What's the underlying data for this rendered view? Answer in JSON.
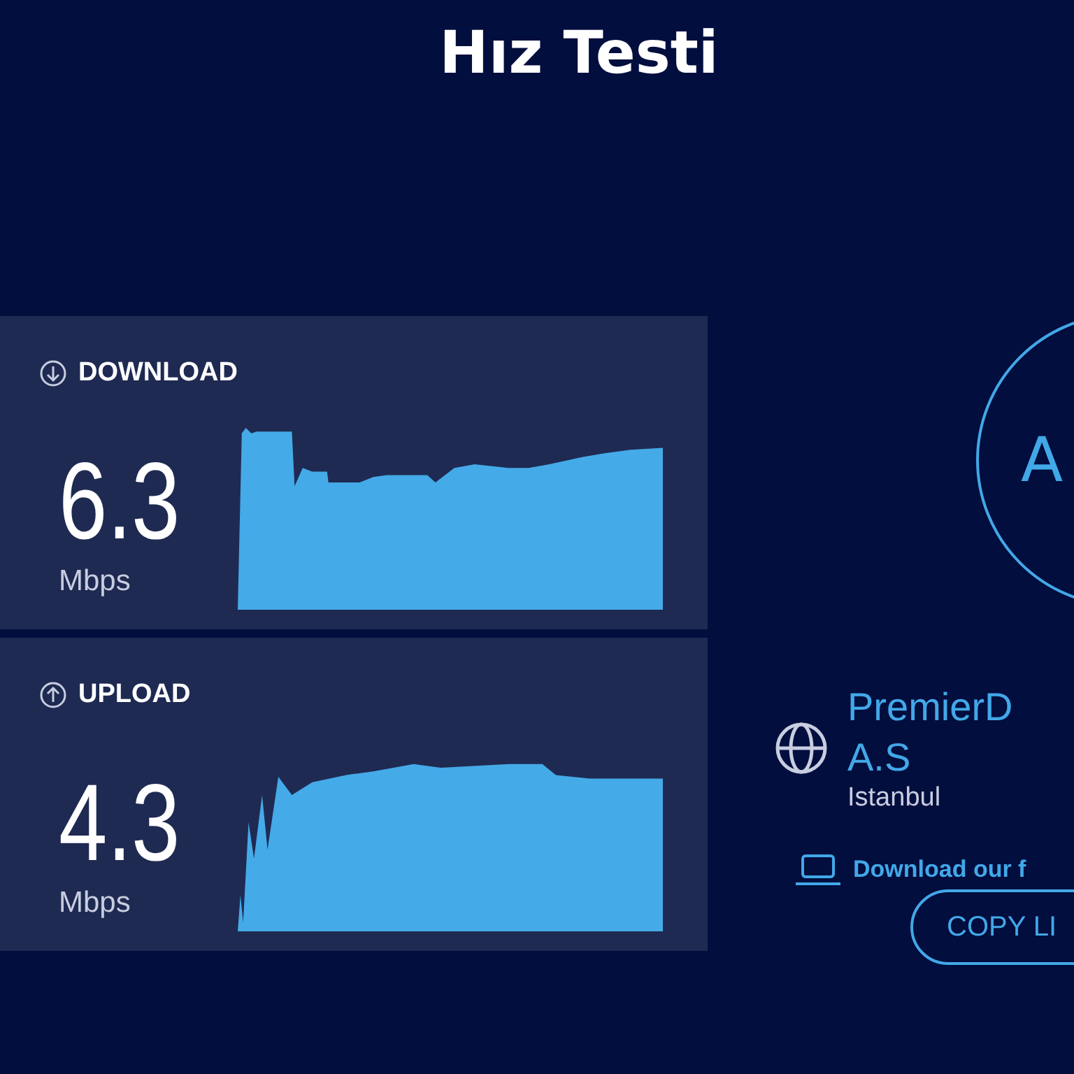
{
  "title": "Hız Testi",
  "results": [
    {
      "kind": "download",
      "label": "DOWNLOAD",
      "value": "6.3",
      "unit": "Mbps"
    },
    {
      "kind": "upload",
      "label": "UPLOAD",
      "value": "4.3",
      "unit": "Mbps"
    }
  ],
  "start_button": {
    "label": "A"
  },
  "provider": {
    "name": "PremierD",
    "name_line_2": "A.S",
    "location": "Istanbul"
  },
  "app_link": "Download our f",
  "copy_button": {
    "label": "COPY LI"
  }
}
